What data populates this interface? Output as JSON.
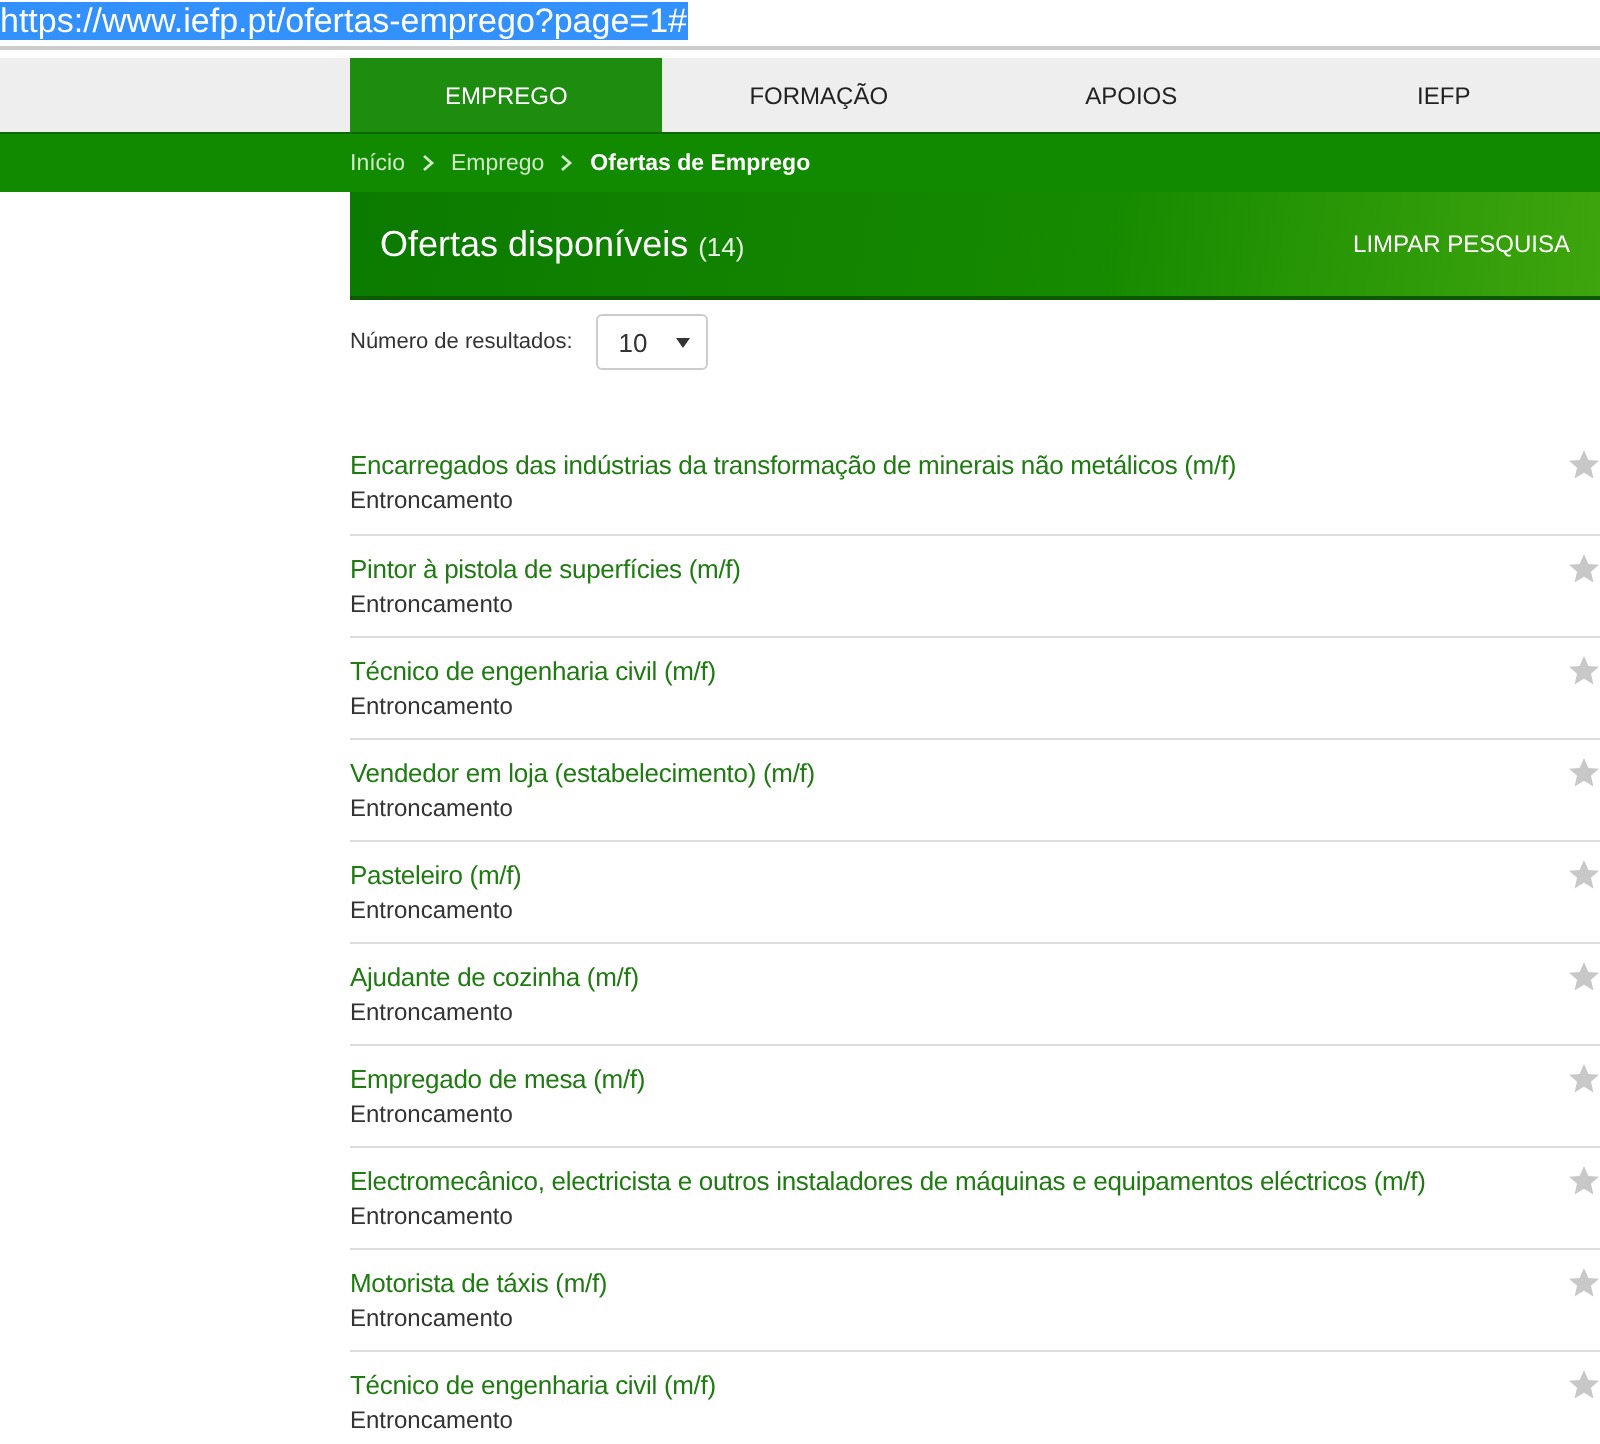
{
  "address_bar": {
    "url": "https://www.iefp.pt/ofertas-emprego?page=1#",
    "selected": true
  },
  "nav_tabs": [
    {
      "label": "EMPREGO",
      "selected": true
    },
    {
      "label": "FORMAÇÃO",
      "selected": false
    },
    {
      "label": "APOIOS",
      "selected": false
    },
    {
      "label": "IEFP",
      "selected": false
    }
  ],
  "breadcrumb": [
    {
      "label": "Início",
      "current": false
    },
    {
      "label": "Emprego",
      "current": false
    },
    {
      "label": "Ofertas de Emprego",
      "current": true
    }
  ],
  "header": {
    "title": "Ofertas disponíveis",
    "count": "(14)",
    "clear_button": "LIMPAR PESQUISA"
  },
  "results_per_page": {
    "label": "Número de resultados:",
    "value": "10"
  },
  "offers": [
    {
      "title": "Encarregados das indústrias da transformação de minerais não metálicos (m/f)",
      "location": "Entroncamento",
      "starred": false
    },
    {
      "title": "Pintor à pistola de superfícies (m/f)",
      "location": "Entroncamento",
      "starred": false
    },
    {
      "title": "Técnico de engenharia civil (m/f)",
      "location": "Entroncamento",
      "starred": false
    },
    {
      "title": "Vendedor em loja (estabelecimento) (m/f)",
      "location": "Entroncamento",
      "starred": false
    },
    {
      "title": "Pasteleiro (m/f)",
      "location": "Entroncamento",
      "starred": false
    },
    {
      "title": "Ajudante de cozinha (m/f)",
      "location": "Entroncamento",
      "starred": false
    },
    {
      "title": "Empregado de mesa (m/f)",
      "location": "Entroncamento",
      "starred": false
    },
    {
      "title": "Electromecânico, electricista e outros instaladores de máquinas e equipamentos eléctricos (m/f)",
      "location": "Entroncamento",
      "starred": false
    },
    {
      "title": "Motorista de táxis (m/f)",
      "location": "Entroncamento",
      "starred": false
    },
    {
      "title": "Técnico de engenharia civil (m/f)",
      "location": "Entroncamento",
      "starred": false
    }
  ]
}
